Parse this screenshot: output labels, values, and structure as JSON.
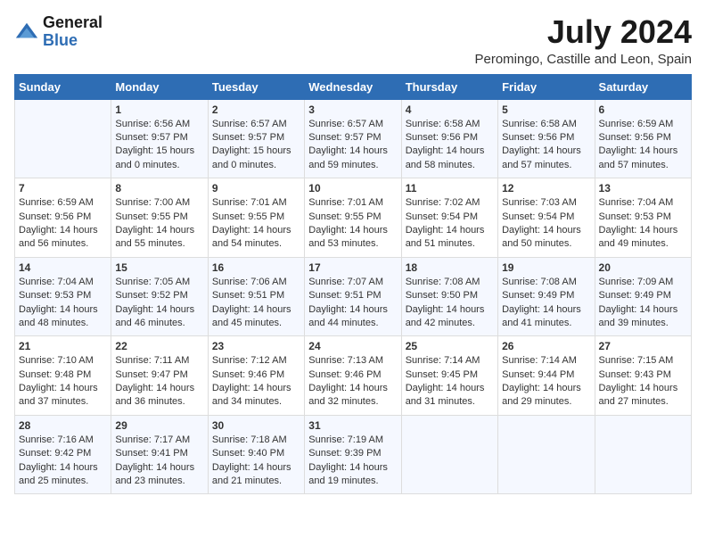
{
  "logo": {
    "general": "General",
    "blue": "Blue"
  },
  "header": {
    "month_year": "July 2024",
    "location": "Peromingo, Castille and Leon, Spain"
  },
  "days_of_week": [
    "Sunday",
    "Monday",
    "Tuesday",
    "Wednesday",
    "Thursday",
    "Friday",
    "Saturday"
  ],
  "weeks": [
    [
      {
        "day": "",
        "content": ""
      },
      {
        "day": "1",
        "content": "Sunrise: 6:56 AM\nSunset: 9:57 PM\nDaylight: 15 hours\nand 0 minutes."
      },
      {
        "day": "2",
        "content": "Sunrise: 6:57 AM\nSunset: 9:57 PM\nDaylight: 15 hours\nand 0 minutes."
      },
      {
        "day": "3",
        "content": "Sunrise: 6:57 AM\nSunset: 9:57 PM\nDaylight: 14 hours\nand 59 minutes."
      },
      {
        "day": "4",
        "content": "Sunrise: 6:58 AM\nSunset: 9:56 PM\nDaylight: 14 hours\nand 58 minutes."
      },
      {
        "day": "5",
        "content": "Sunrise: 6:58 AM\nSunset: 9:56 PM\nDaylight: 14 hours\nand 57 minutes."
      },
      {
        "day": "6",
        "content": "Sunrise: 6:59 AM\nSunset: 9:56 PM\nDaylight: 14 hours\nand 57 minutes."
      }
    ],
    [
      {
        "day": "7",
        "content": "Sunrise: 6:59 AM\nSunset: 9:56 PM\nDaylight: 14 hours\nand 56 minutes."
      },
      {
        "day": "8",
        "content": "Sunrise: 7:00 AM\nSunset: 9:55 PM\nDaylight: 14 hours\nand 55 minutes."
      },
      {
        "day": "9",
        "content": "Sunrise: 7:01 AM\nSunset: 9:55 PM\nDaylight: 14 hours\nand 54 minutes."
      },
      {
        "day": "10",
        "content": "Sunrise: 7:01 AM\nSunset: 9:55 PM\nDaylight: 14 hours\nand 53 minutes."
      },
      {
        "day": "11",
        "content": "Sunrise: 7:02 AM\nSunset: 9:54 PM\nDaylight: 14 hours\nand 51 minutes."
      },
      {
        "day": "12",
        "content": "Sunrise: 7:03 AM\nSunset: 9:54 PM\nDaylight: 14 hours\nand 50 minutes."
      },
      {
        "day": "13",
        "content": "Sunrise: 7:04 AM\nSunset: 9:53 PM\nDaylight: 14 hours\nand 49 minutes."
      }
    ],
    [
      {
        "day": "14",
        "content": "Sunrise: 7:04 AM\nSunset: 9:53 PM\nDaylight: 14 hours\nand 48 minutes."
      },
      {
        "day": "15",
        "content": "Sunrise: 7:05 AM\nSunset: 9:52 PM\nDaylight: 14 hours\nand 46 minutes."
      },
      {
        "day": "16",
        "content": "Sunrise: 7:06 AM\nSunset: 9:51 PM\nDaylight: 14 hours\nand 45 minutes."
      },
      {
        "day": "17",
        "content": "Sunrise: 7:07 AM\nSunset: 9:51 PM\nDaylight: 14 hours\nand 44 minutes."
      },
      {
        "day": "18",
        "content": "Sunrise: 7:08 AM\nSunset: 9:50 PM\nDaylight: 14 hours\nand 42 minutes."
      },
      {
        "day": "19",
        "content": "Sunrise: 7:08 AM\nSunset: 9:49 PM\nDaylight: 14 hours\nand 41 minutes."
      },
      {
        "day": "20",
        "content": "Sunrise: 7:09 AM\nSunset: 9:49 PM\nDaylight: 14 hours\nand 39 minutes."
      }
    ],
    [
      {
        "day": "21",
        "content": "Sunrise: 7:10 AM\nSunset: 9:48 PM\nDaylight: 14 hours\nand 37 minutes."
      },
      {
        "day": "22",
        "content": "Sunrise: 7:11 AM\nSunset: 9:47 PM\nDaylight: 14 hours\nand 36 minutes."
      },
      {
        "day": "23",
        "content": "Sunrise: 7:12 AM\nSunset: 9:46 PM\nDaylight: 14 hours\nand 34 minutes."
      },
      {
        "day": "24",
        "content": "Sunrise: 7:13 AM\nSunset: 9:46 PM\nDaylight: 14 hours\nand 32 minutes."
      },
      {
        "day": "25",
        "content": "Sunrise: 7:14 AM\nSunset: 9:45 PM\nDaylight: 14 hours\nand 31 minutes."
      },
      {
        "day": "26",
        "content": "Sunrise: 7:14 AM\nSunset: 9:44 PM\nDaylight: 14 hours\nand 29 minutes."
      },
      {
        "day": "27",
        "content": "Sunrise: 7:15 AM\nSunset: 9:43 PM\nDaylight: 14 hours\nand 27 minutes."
      }
    ],
    [
      {
        "day": "28",
        "content": "Sunrise: 7:16 AM\nSunset: 9:42 PM\nDaylight: 14 hours\nand 25 minutes."
      },
      {
        "day": "29",
        "content": "Sunrise: 7:17 AM\nSunset: 9:41 PM\nDaylight: 14 hours\nand 23 minutes."
      },
      {
        "day": "30",
        "content": "Sunrise: 7:18 AM\nSunset: 9:40 PM\nDaylight: 14 hours\nand 21 minutes."
      },
      {
        "day": "31",
        "content": "Sunrise: 7:19 AM\nSunset: 9:39 PM\nDaylight: 14 hours\nand 19 minutes."
      },
      {
        "day": "",
        "content": ""
      },
      {
        "day": "",
        "content": ""
      },
      {
        "day": "",
        "content": ""
      }
    ]
  ]
}
